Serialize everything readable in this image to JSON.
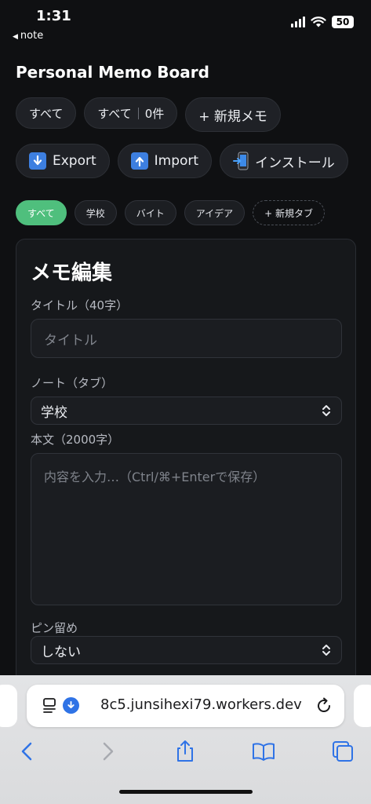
{
  "status": {
    "time": "1:31",
    "back_label": "note",
    "battery": "50"
  },
  "header": {
    "title": "Personal Memo Board"
  },
  "filter_row": {
    "all_label": "すべて",
    "count_category": "すべて",
    "count_value": "0件",
    "new_memo_label": "+ 新規メモ"
  },
  "action_row": {
    "export_label": "Export",
    "import_label": "Import",
    "install_label": "インストール"
  },
  "tabs": [
    {
      "label": "すべて",
      "active": true
    },
    {
      "label": "学校",
      "active": false
    },
    {
      "label": "バイト",
      "active": false
    },
    {
      "label": "アイデア",
      "active": false
    },
    {
      "label": "+ 新規タブ",
      "active": false
    }
  ],
  "editor": {
    "heading": "メモ編集",
    "title_label": "タイトル（40字）",
    "title_placeholder": "タイトル",
    "note_label": "ノート（タブ）",
    "note_value": "学校",
    "body_label": "本文（2000字）",
    "body_placeholder": "内容を入力…（Ctrl/⌘+Enterで保存）",
    "pin_label": "ピン留め",
    "pin_value": "しない"
  },
  "browser": {
    "url": "8c5.junsihexi79.workers.dev"
  },
  "colors": {
    "accent_green": "#4fbf7d",
    "background": "#0f1012",
    "ios_blue": "#2f73e6"
  }
}
